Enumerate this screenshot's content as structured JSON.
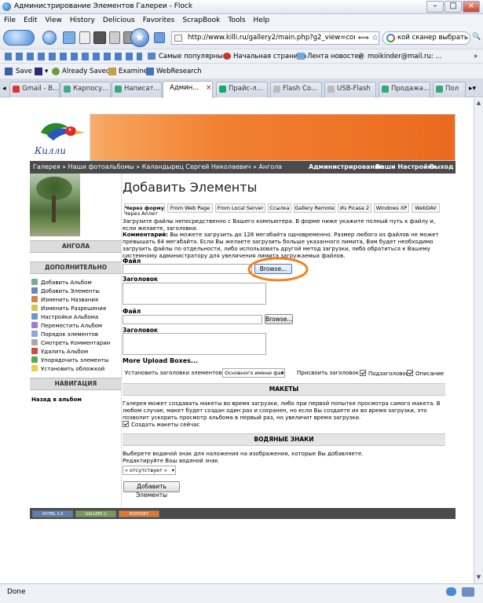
{
  "window": {
    "title": "Администрирование Элементов Галереи - Flock"
  },
  "menu": [
    "File",
    "Edit",
    "View",
    "History",
    "Delicious",
    "Favorites",
    "ScrapBook",
    "Tools",
    "Help"
  ],
  "nav": {
    "url": "http://www.killi.ru/gallery2/main.php?g2_view=core.ItemA",
    "search": "кой сканер выбрать"
  },
  "bookmarks": [
    "Самые популярные",
    "Начальная страница",
    "Лента новостей",
    "moikinder@mail.ru: ..."
  ],
  "toolbar": {
    "save": "Save",
    "already_saved": "Already Saved?",
    "examine": "Examine",
    "webresearch": "WebResearch"
  },
  "tabs": [
    {
      "label": "Gmail - B...",
      "color": "#d33"
    },
    {
      "label": "Карпосу...",
      "color": "#4a8"
    },
    {
      "label": "Написат...",
      "color": "#3a7"
    },
    {
      "label": "Админ...",
      "color": "#fff",
      "active": true,
      "close": "×"
    },
    {
      "label": "Прайс-л...",
      "color": "#1a6"
    },
    {
      "label": "Flash Co...",
      "color": "#bbb"
    },
    {
      "label": "USB-Flash",
      "color": "#bbb"
    },
    {
      "label": "Продажа...",
      "color": "#3a7"
    },
    {
      "label": "Пол",
      "color": "#3a7"
    }
  ],
  "status": {
    "text": "Done"
  },
  "site": {
    "logo_text": "Килли",
    "breadcrumb": "Галерея » Наши фотоальбомы » Каландырец Сергей Николаевич » Ангола",
    "admin_links": [
      "Администрирование",
      "Ваши Настройки",
      "Выход"
    ],
    "album_title": "АНГОЛА",
    "sidebar_more": "ДОПОЛНИТЕЛЬНО",
    "sidebar_items": [
      {
        "label": "Добавить Альбом",
        "color": "#7a9"
      },
      {
        "label": "Добавить Элементы",
        "color": "#68b"
      },
      {
        "label": "Изменить Названия",
        "color": "#c84"
      },
      {
        "label": "Изменить Разрешения",
        "color": "#cc5"
      },
      {
        "label": "Настройки Альбома",
        "color": "#69c"
      },
      {
        "label": "Переместить Альбом",
        "color": "#a7c"
      },
      {
        "label": "Порядок элементов",
        "color": "#8ad"
      },
      {
        "label": "Смотреть Комментарии",
        "color": "#aaa"
      },
      {
        "label": "Удалить Альбом",
        "color": "#d44"
      },
      {
        "label": "Упорядочить элементы",
        "color": "#5a5"
      },
      {
        "label": "Установить обложкой",
        "color": "#ec4"
      }
    ],
    "sidebar_nav": "НАВИГАЦИЯ",
    "sidebar_back": "Назад в альбом",
    "footer_badges": [
      "XHTML 1.0",
      "GALLERY 2",
      "КОНТАКТ"
    ]
  },
  "main": {
    "title": "Добавить Элементы",
    "tabs": [
      "Через форму",
      "From Web Page",
      "From Local Server",
      "Ссылка",
      "Gallery Remote",
      "Из Picasa 2",
      "Windows XP",
      "WebDAV",
      "Через Аплет"
    ],
    "intro": "Загрузите файлы непосредственно с Вашего компьютера. В форме ниже укажите полный путь к файлу и, если желаете, заголовки.",
    "comment_label": "Комментарий:",
    "comment": "Вы можете загрузить до 128 мегабайта одновременно. Размер любого из файлов не может превышать 64 мегабайта. Если Вы желаете загрузить больше указанного лимита, Вам будет необходимо загрузить файлы по отдельности, либо использовать другой метод загрузки, либо обратиться к Вашему системному администратору для увеличения лимита загружаемых файлов.",
    "file_label": "Файл",
    "caption_label": "Заголовок",
    "browse_label": "Browse...",
    "more_boxes": "More Upload Boxes...",
    "set_captions_label": "Установить заголовки элементов как:",
    "set_captions_value": "Основного имени файла",
    "assign_label": "Присвоить заголовок к:",
    "opt_subtitle": "Подзаголовок",
    "opt_description": "Описание",
    "section_thumbs": "МАКЕТЫ",
    "thumbs_text": "Галерея может создавать макеты во время загрузки, либо при первой попытке просмотра самого макета. В любом случае, макет будет создан один раз и сохранен, но если Вы создаете их во время загрузки, это позволит ускорить просмотр альбома в первый раз, но увеличит время загрузки.",
    "thumbs_checkbox": "Создать макеты сейчас",
    "section_watermark": "ВОДЯНЫЕ ЗНАКИ",
    "watermark_text": "Выберете водяной знак для наложения на изображения, которые Вы добавляете.",
    "watermark_edit": "Редактируйте Ваш водяной знак",
    "watermark_select": "« отсутствует »",
    "submit": "Добавить Элементы"
  }
}
